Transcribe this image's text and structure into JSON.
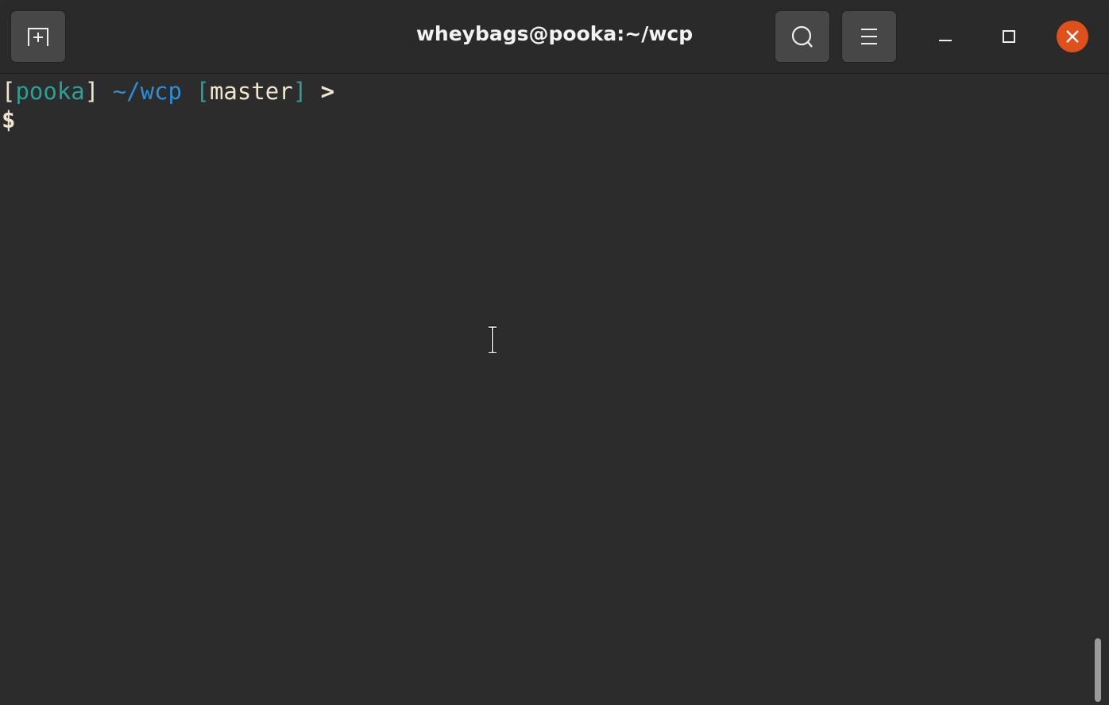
{
  "window": {
    "title": "wheybags@pooka:~/wcp"
  },
  "header": {
    "new_tab_icon": "new-tab-icon",
    "search_icon": "search-icon",
    "menu_icon": "hamburger-menu-icon",
    "close_color": "#e0501a"
  },
  "terminal": {
    "prompt": {
      "open_bracket": "[",
      "host": "pooka",
      "close_bracket": "]",
      "path": "~/wcp",
      "branch_open": "[",
      "branch": "master",
      "branch_close": "]",
      "arrow": ">",
      "dollar": "$"
    },
    "colors": {
      "host": "#2aa198",
      "path": "#2b8fd8",
      "text": "#efe6cc"
    }
  }
}
